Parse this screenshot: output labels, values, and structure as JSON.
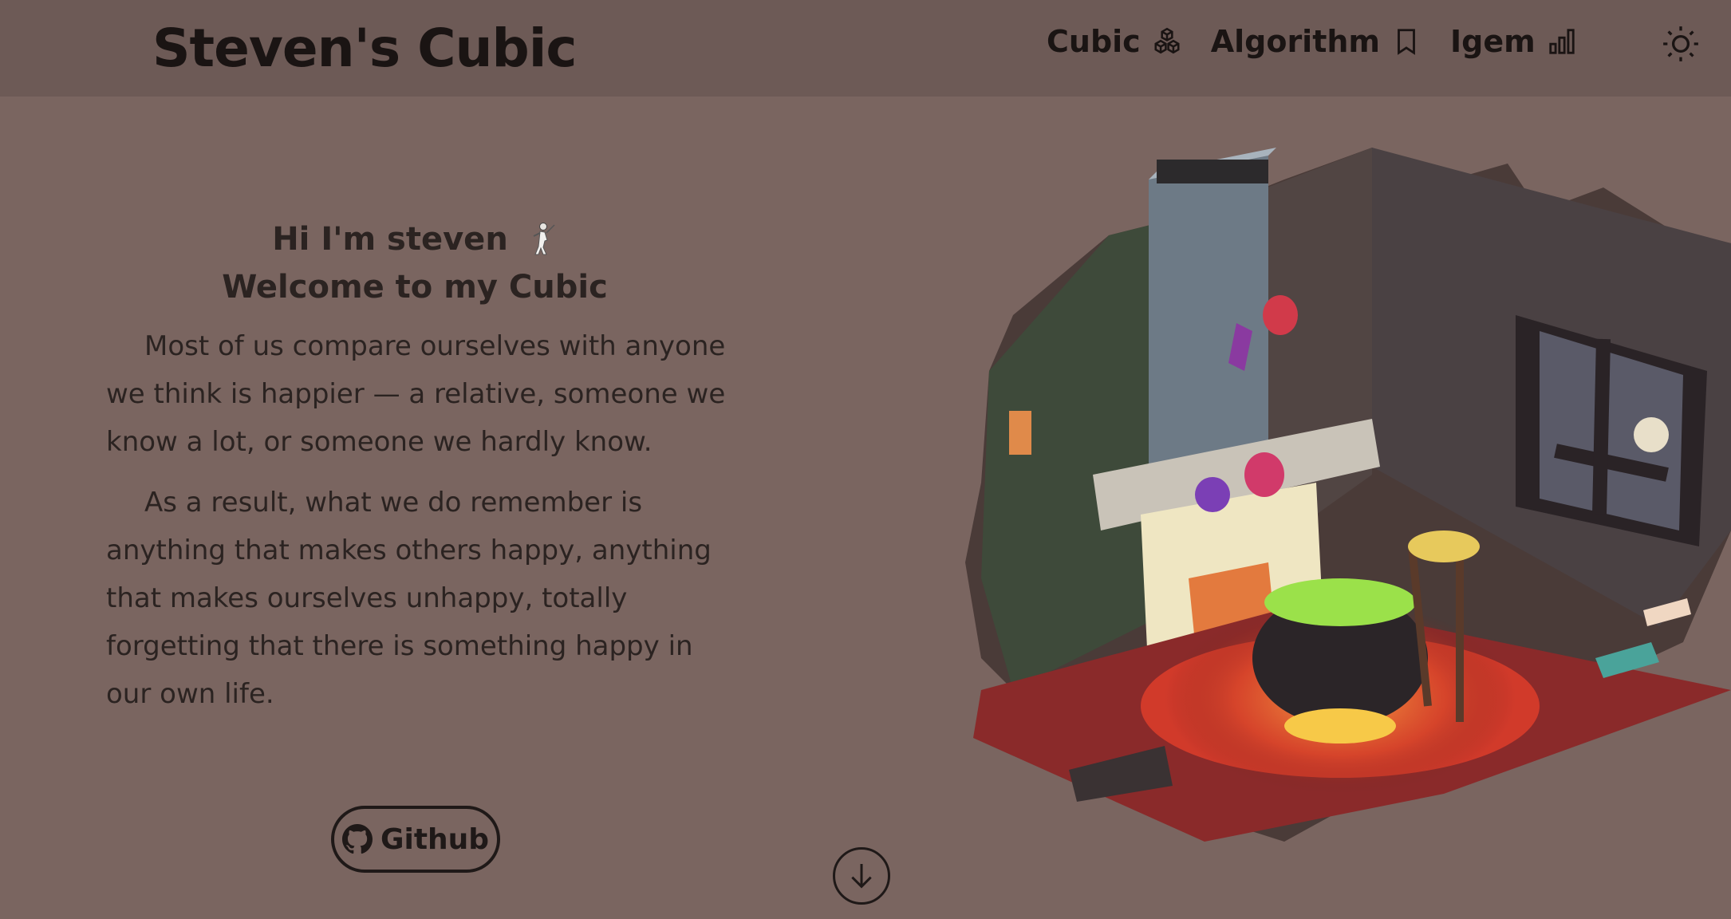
{
  "header": {
    "brand": "Steven's Cubic",
    "nav": [
      {
        "label": "Cubic",
        "icon": "boxes-icon"
      },
      {
        "label": "Algorithm",
        "icon": "bookmark-icon"
      },
      {
        "label": "Igem",
        "icon": "bar-chart-icon"
      }
    ],
    "theme_icon": "sun-icon"
  },
  "intro": {
    "greeting_line1": "Hi I'm steven",
    "greeting_line2": "Welcome to my Cubic",
    "paragraph1": "Most of us compare ourselves with anyone we think is happier — a relative, someone we know a lot, or someone we hardly know.",
    "paragraph2": "As a result, what we do remember is anything that makes others happy, anything that makes ourselves unhappy, totally forgetting that there is something happy in our own life."
  },
  "github_button": {
    "label": "Github",
    "icon": "github-icon"
  },
  "scroll_icon": "arrow-down-circle-icon",
  "colors": {
    "background": "#7a6560",
    "navbar": "#6d5a56",
    "text": "#2b2321"
  }
}
